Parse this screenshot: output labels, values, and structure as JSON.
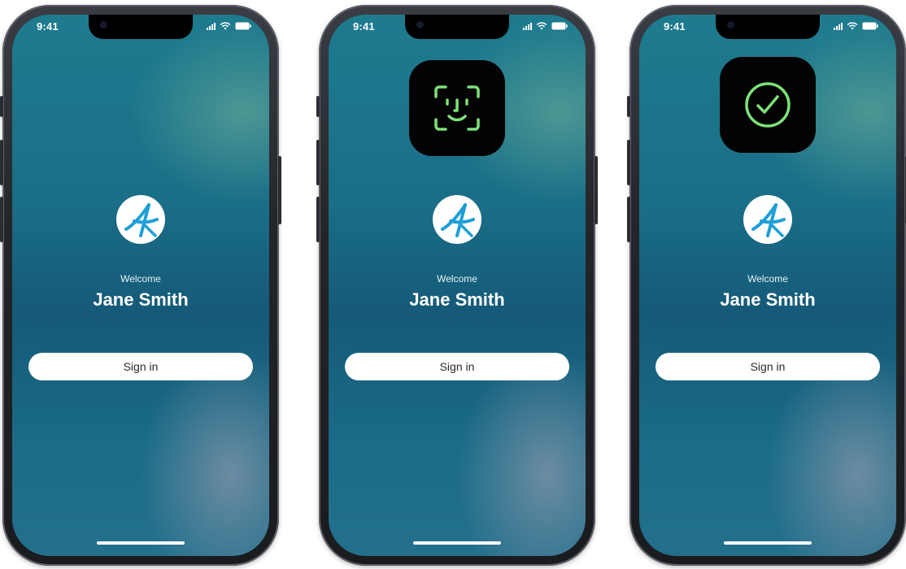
{
  "colors": {
    "accent_green": "#7ee07a",
    "logo_blue": "#1f9fd6"
  },
  "phones": [
    {
      "status_time": "9:41",
      "welcome": "Welcome",
      "name": "Jane Smith",
      "signin_label": "Sign in",
      "overlay_icon": null
    },
    {
      "status_time": "9:41",
      "welcome": "Welcome",
      "name": "Jane Smith",
      "signin_label": "Sign in",
      "overlay_icon": "face-id-icon"
    },
    {
      "status_time": "9:41",
      "welcome": "Welcome",
      "name": "Jane Smith",
      "signin_label": "Sign in",
      "overlay_icon": "checkmark-circle-icon"
    }
  ]
}
